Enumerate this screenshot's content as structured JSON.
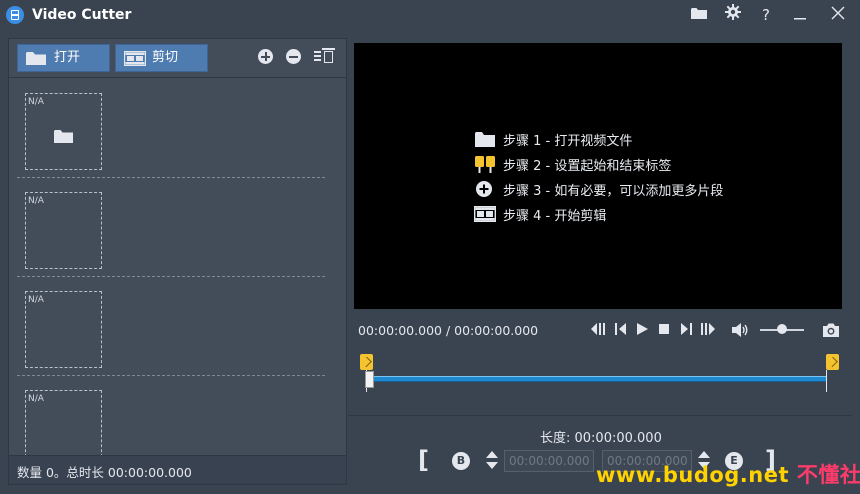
{
  "window": {
    "title": "Video Cutter",
    "icons": [
      "folder-icon",
      "gear-icon",
      "help-icon",
      "minimize-icon",
      "close-icon"
    ],
    "help_label": "?"
  },
  "toolbar": {
    "open_label": "打开",
    "cut_label": "剪切"
  },
  "clips": [
    {
      "label": "N/A",
      "has_folder": true
    },
    {
      "label": "N/A"
    },
    {
      "label": "N/A"
    },
    {
      "label": "N/A"
    }
  ],
  "status": {
    "summary": "数量 0。总时长 00:00:00.000"
  },
  "player": {
    "steps": [
      {
        "icon": "folder-icon",
        "text": "步骤 1 - 打开视频文件"
      },
      {
        "icon": "markers-icon",
        "text": "步骤 2 - 设置起始和结束标签"
      },
      {
        "icon": "add-circle-icon",
        "text": "步骤 3 - 如有必要，可以添加更多片段"
      },
      {
        "icon": "film-icon",
        "text": "步骤 4 - 开始剪辑"
      }
    ],
    "time": "00:00:00.000 / 00:00:00.000",
    "volume": 0.45
  },
  "segment": {
    "length_label": "长度: 00:00:00.000",
    "start_letter": "B",
    "end_letter": "E",
    "start_value": "00:00:00.000",
    "end_value": "00:00:00.000",
    "left_bracket": "[",
    "right_bracket": "]"
  },
  "watermark": {
    "site": "www.budog.net",
    "name": "不懂社区"
  },
  "colors": {
    "background": "#3a4350",
    "accent": "#4f7cb0",
    "timeline": "#1e89cf",
    "marker": "#f4c430",
    "watermark": "#ff3b6b"
  }
}
